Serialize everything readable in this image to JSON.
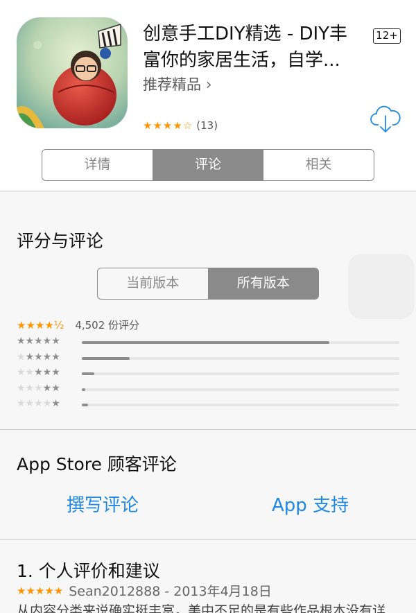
{
  "app": {
    "title": "创意手工DIY精选 - DIY丰富你的家居生活，自学...",
    "age_rating": "12+",
    "publisher": "推荐精品",
    "rating_stars": "★★★★☆",
    "rating_count": "(13)",
    "icon": "app-icon-illustration"
  },
  "tabs": [
    {
      "label": "详情",
      "active": false
    },
    {
      "label": "评论",
      "active": true
    },
    {
      "label": "相关",
      "active": false
    }
  ],
  "ratings_section": {
    "title": "评分与评论",
    "version_tabs": [
      {
        "label": "当前版本",
        "active": false
      },
      {
        "label": "所有版本",
        "active": true
      }
    ],
    "overall_stars": "★★★★½",
    "overall_count": "4,502 份评分",
    "histogram": [
      {
        "stars": 5,
        "fraction": 0.78
      },
      {
        "stars": 4,
        "fraction": 0.15
      },
      {
        "stars": 3,
        "fraction": 0.04
      },
      {
        "stars": 2,
        "fraction": 0.01
      },
      {
        "stars": 1,
        "fraction": 0.02
      }
    ]
  },
  "customer_reviews": {
    "title": "App Store 顾客评论",
    "write_review": "撰写评论",
    "app_support": "App 支持"
  },
  "review": {
    "title": "1. 个人评价和建议",
    "stars": "★★★★★",
    "author_date": "Sean2012888 - 2013年4月18日",
    "body": "从内容分类来说确实挺丰富，美中不足的是有些作品根本没有详"
  },
  "colors": {
    "accent_blue": "#1e88e5",
    "star_orange": "#ff9500",
    "segment_active": "#8a8a8a"
  }
}
